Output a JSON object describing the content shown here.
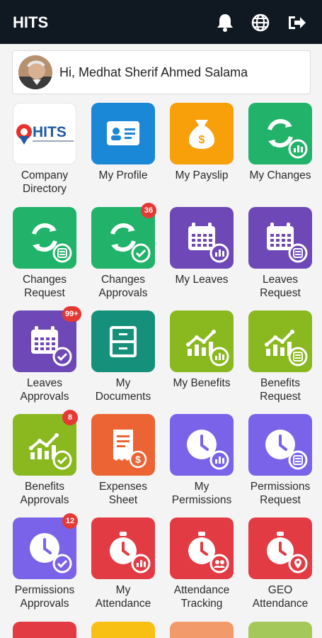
{
  "header": {
    "title": "HITS",
    "icons": [
      "bell-icon",
      "globe-icon",
      "logout-icon"
    ]
  },
  "greeting": {
    "text": "Hi, Medhat Sherif Ahmed Salama"
  },
  "logo": {
    "text": "HITS"
  },
  "tiles": [
    {
      "line1": "Company",
      "line2": "Directory",
      "color": "#ffffff",
      "badge": ""
    },
    {
      "line1": "My Profile",
      "line2": "",
      "color": "#1a88d6",
      "badge": ""
    },
    {
      "line1": "My Payslip",
      "line2": "",
      "color": "#f7a00a",
      "badge": ""
    },
    {
      "line1": "My Changes",
      "line2": "",
      "color": "#21b36a",
      "badge": ""
    },
    {
      "line1": "Changes",
      "line2": "Request",
      "color": "#21b36a",
      "badge": ""
    },
    {
      "line1": "Changes",
      "line2": "Approvals",
      "color": "#21b36a",
      "badge": "36"
    },
    {
      "line1": "My Leaves",
      "line2": "",
      "color": "#6d48b6",
      "badge": ""
    },
    {
      "line1": "Leaves",
      "line2": "Request",
      "color": "#6d48b6",
      "badge": ""
    },
    {
      "line1": "Leaves",
      "line2": "Approvals",
      "color": "#6d48b6",
      "badge": "99+"
    },
    {
      "line1": "My",
      "line2": "Documents",
      "color": "#15917b",
      "badge": ""
    },
    {
      "line1": "My Benefits",
      "line2": "",
      "color": "#8ab81f",
      "badge": ""
    },
    {
      "line1": "Benefits",
      "line2": "Request",
      "color": "#8ab81f",
      "badge": ""
    },
    {
      "line1": "Benefits",
      "line2": "Approvals",
      "color": "#8ab81f",
      "badge": "8"
    },
    {
      "line1": "Expenses",
      "line2": "Sheet",
      "color": "#ec6434",
      "badge": ""
    },
    {
      "line1": "My",
      "line2": "Permissions",
      "color": "#7a63e8",
      "badge": ""
    },
    {
      "line1": "Permissions",
      "line2": "Request",
      "color": "#7a63e8",
      "badge": ""
    },
    {
      "line1": "Permissions",
      "line2": "Approvals",
      "color": "#7a63e8",
      "badge": "12"
    },
    {
      "line1": "My",
      "line2": "Attendance",
      "color": "#e23b43",
      "badge": ""
    },
    {
      "line1": "Attendance",
      "line2": "Tracking",
      "color": "#e23b43",
      "badge": ""
    },
    {
      "line1": "GEO",
      "line2": "Attendance",
      "color": "#e23b43",
      "badge": ""
    }
  ],
  "partial_row_colors": [
    "#e23b43",
    "#f7c012",
    "#f39a6b",
    "#a5c85a"
  ]
}
